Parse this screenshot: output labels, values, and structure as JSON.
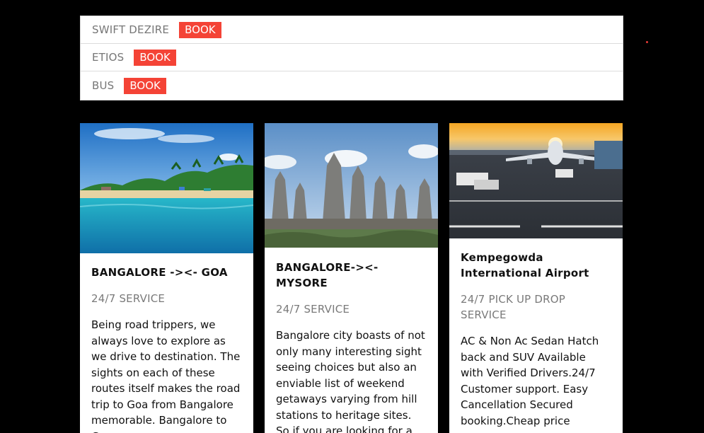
{
  "vehicles": [
    {
      "name": "SWIFT DEZIRE",
      "action": "BOOK"
    },
    {
      "name": "ETIOS",
      "action": "BOOK"
    },
    {
      "name": "BUS",
      "action": "BOOK"
    }
  ],
  "colors": {
    "background": "#000000",
    "accent": "#f44336",
    "muted_text": "#7a7a7a"
  },
  "cards": [
    {
      "title": "BANGALORE -><- GOA",
      "subtitle": "24/7 SERVICE",
      "text": "Being road trippers, we always love to explore as we drive to destination. The sights on each of these routes itself makes the road trip to Goa from Bangalore memorable. Bangalore to Goa..."
    },
    {
      "title": "BANGALORE-><- MYSORE",
      "subtitle": "24/7 SERVICE",
      "text": "Bangalore city boasts of not only many interesting sight seeing choices but also an enviable list of weekend getaways varying from hill stations to heritage sites. So if you are looking for a"
    },
    {
      "title": "Kempegowda International Airport",
      "subtitle": "24/7 PICK UP DROP SERVICE",
      "text": "AC & Non Ac Sedan Hatch back and SUV Available with Verified Drivers.24/7 Customer support. Easy Cancellation Secured booking.Cheap price"
    }
  ]
}
